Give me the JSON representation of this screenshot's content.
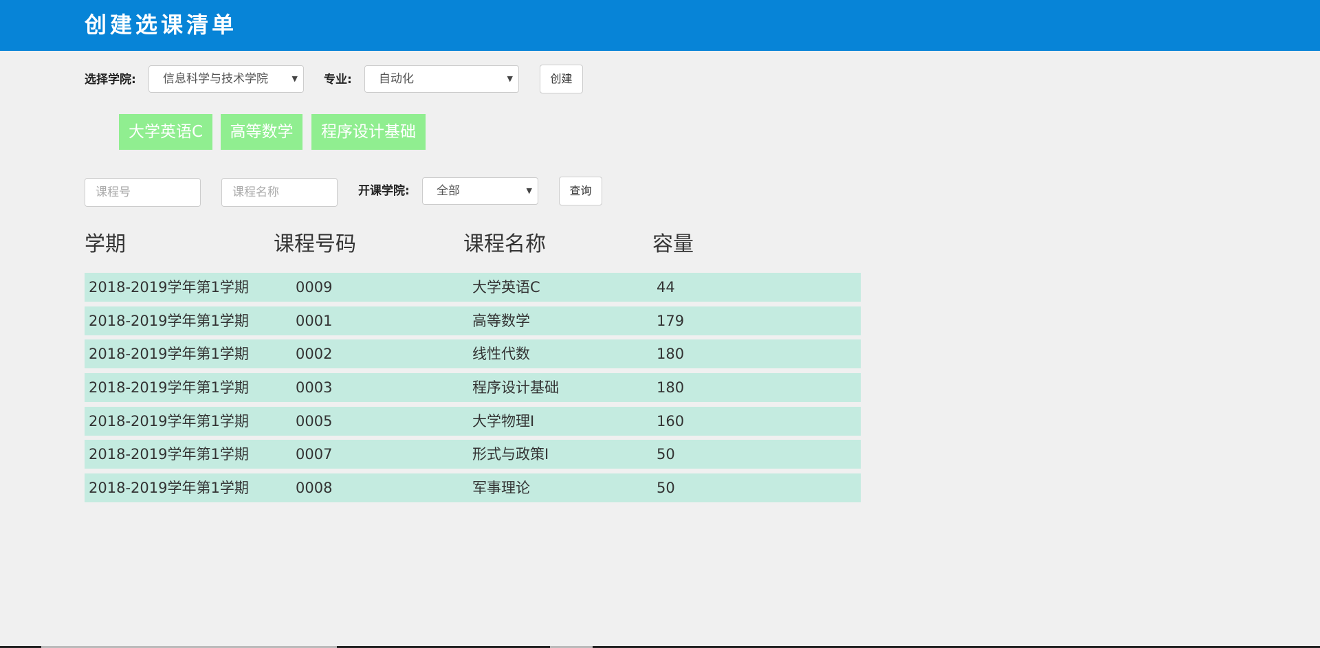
{
  "header": {
    "title": "创建选课清单"
  },
  "create_form": {
    "college_label": "选择学院:",
    "college_value": "信息科学与技术学院",
    "major_label": "专业:",
    "major_value": "自动化",
    "create_button": "创建"
  },
  "selected_courses": [
    "大学英语C",
    "高等数学",
    "程序设计基础"
  ],
  "search": {
    "course_no_placeholder": "课程号",
    "course_name_placeholder": "课程名称",
    "college_label": "开课学院:",
    "college_value": "全部",
    "query_button": "查询"
  },
  "table": {
    "headers": [
      "学期",
      "课程号码",
      "课程名称",
      "容量"
    ],
    "rows": [
      [
        "2018-2019学年第1学期",
        "0009",
        "大学英语C",
        "44"
      ],
      [
        "2018-2019学年第1学期",
        "0001",
        "高等数学",
        "179"
      ],
      [
        "2018-2019学年第1学期",
        "0002",
        "线性代数",
        "180"
      ],
      [
        "2018-2019学年第1学期",
        "0003",
        "程序设计基础",
        "180"
      ],
      [
        "2018-2019学年第1学期",
        "0005",
        "大学物理I",
        "160"
      ],
      [
        "2018-2019学年第1学期",
        "0007",
        "形式与政策I",
        "50"
      ],
      [
        "2018-2019学年第1学期",
        "0008",
        "军事理论",
        "50"
      ]
    ]
  },
  "colors": {
    "header_bg": "#0784d7",
    "tag_bg": "#90ee90",
    "row_bg": "#c4ebe0",
    "page_bg": "#f0f0f0"
  }
}
